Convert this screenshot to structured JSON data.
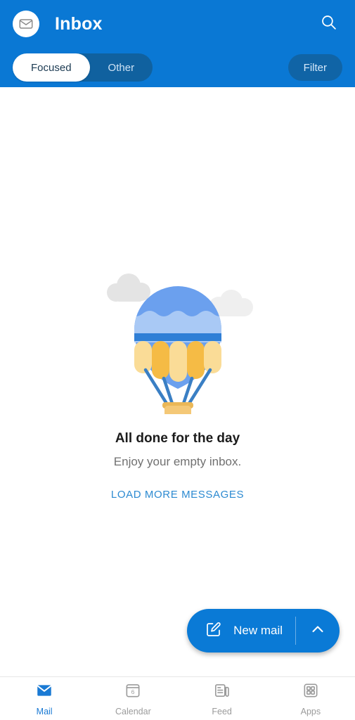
{
  "header": {
    "title": "Inbox",
    "avatar_icon": "envelope-outline-icon",
    "search_icon": "search-icon",
    "background_color": "#0a78d4",
    "segments": [
      {
        "label": "Focused",
        "active": true
      },
      {
        "label": "Other",
        "active": false
      }
    ],
    "filter_label": "Filter"
  },
  "empty_state": {
    "illustration": "hot-air-balloon-illustration",
    "title": "All done for the day",
    "subtitle": "Enjoy your empty inbox.",
    "action_label": "LOAD MORE MESSAGES",
    "action_color": "#2c8ad1",
    "illustration_colors": {
      "balloon_blue": "#6ba0ee",
      "balloon_light_blue": "#a9c9f5",
      "balloon_stripe": "#2f7fd6",
      "panel_light": "#fadc97",
      "panel_dark": "#f5bb45",
      "basket": "#f4c877",
      "rope": "#3a7fc4",
      "cloud_left": "#e4e4e4",
      "cloud_right": "#efefef"
    }
  },
  "fab": {
    "compose_icon": "compose-icon",
    "label": "New mail",
    "chevron_icon": "chevron-up-icon",
    "color": "#0a7ad6"
  },
  "bottom_nav": {
    "active_color": "#1a7ad4",
    "inactive_color": "#9b9b9b",
    "items": [
      {
        "label": "Mail",
        "icon": "mail-icon",
        "active": true,
        "badge": ""
      },
      {
        "label": "Calendar",
        "icon": "calendar-icon",
        "active": false,
        "badge": "6"
      },
      {
        "label": "Feed",
        "icon": "feed-icon",
        "active": false,
        "badge": ""
      },
      {
        "label": "Apps",
        "icon": "apps-grid-icon",
        "active": false,
        "badge": ""
      }
    ]
  }
}
